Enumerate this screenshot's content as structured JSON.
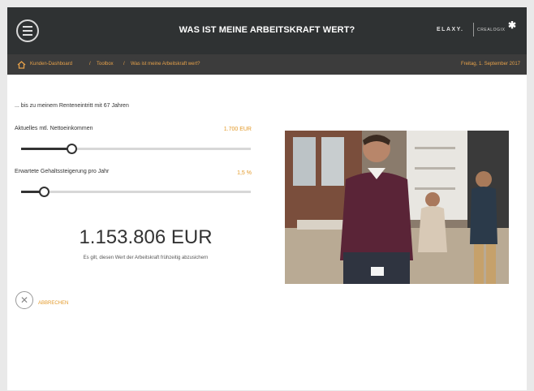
{
  "header": {
    "title": "WAS IST MEINE ARBEITSKRAFT WERT?",
    "brand_primary": "ELAXY.",
    "brand_secondary": "CREALOGIX",
    "brand_star": "✱"
  },
  "breadcrumb": {
    "items": [
      "Kunden-Dashboard",
      "Toolbox",
      "Was ist meine Arbeitskraft wert?"
    ],
    "separator": "/",
    "date": "Freitag, 1. September 2017"
  },
  "calculator": {
    "intro": "... bis zu meinem Renteneintritt mit 67 Jahren",
    "income": {
      "label": "Aktuelles mtl. Nettoeinkommen",
      "value": "1.700 EUR",
      "level": 0.22
    },
    "raise": {
      "label": "Erwartete Gehaltssteigerung pro Jahr",
      "value": "1,5 %",
      "level": 0.1
    },
    "result": "1.153.806 EUR",
    "result_note": "Es gilt, diesen Wert der Arbeitskraft frühzeitig abzusichern"
  },
  "actions": {
    "cancel_label": "ABBRECHEN",
    "cancel_icon": "close-icon"
  },
  "icons": {
    "menu": "hamburger-menu-icon",
    "home": "home-icon"
  },
  "colors": {
    "accent": "#e39a2a",
    "header": "#2f3233",
    "crumbbar": "#3c3c3c"
  }
}
